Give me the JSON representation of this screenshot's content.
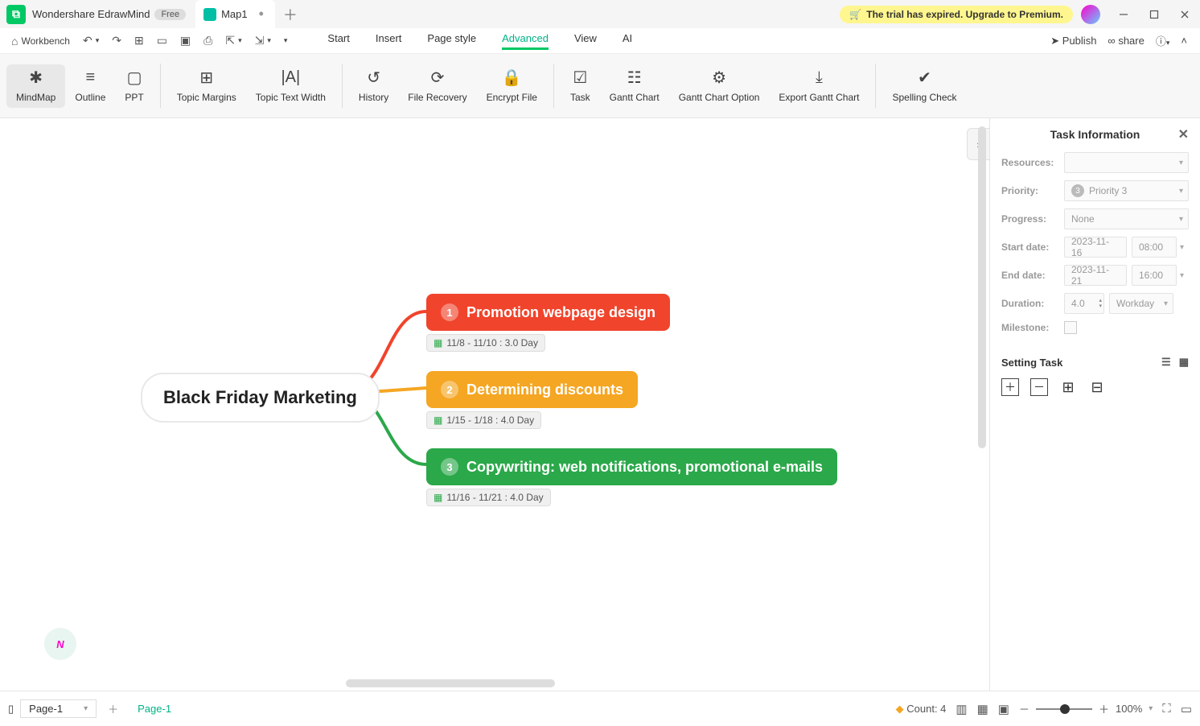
{
  "titlebar": {
    "app_name": "Wondershare EdrawMind",
    "free_badge": "Free",
    "tab_name": "Map1",
    "trial_msg": "The trial has expired. Upgrade to Premium."
  },
  "quickbar": {
    "workbench": "Workbench"
  },
  "menu": {
    "items": [
      "Start",
      "Insert",
      "Page style",
      "Advanced",
      "View",
      "AI"
    ],
    "active": "Advanced"
  },
  "top_actions": {
    "publish": "Publish",
    "share": "share"
  },
  "ribbon": {
    "view": [
      {
        "id": "mindmap",
        "label": "MindMap"
      },
      {
        "id": "outline",
        "label": "Outline"
      },
      {
        "id": "ppt",
        "label": "PPT"
      }
    ],
    "topic": [
      {
        "id": "topic-margins",
        "label": "Topic Margins"
      },
      {
        "id": "topic-text-width",
        "label": "Topic Text Width"
      }
    ],
    "tools": [
      {
        "id": "history",
        "label": "History"
      },
      {
        "id": "file-recovery",
        "label": "File Recovery"
      },
      {
        "id": "encrypt-file",
        "label": "Encrypt File"
      }
    ],
    "task": [
      {
        "id": "task",
        "label": "Task"
      },
      {
        "id": "gantt-chart",
        "label": "Gantt Chart"
      },
      {
        "id": "gantt-chart-option",
        "label": "Gantt Chart Option"
      },
      {
        "id": "export-gantt-chart",
        "label": "Export Gantt Chart"
      }
    ],
    "spell": [
      {
        "id": "spelling-check",
        "label": "Spelling Check"
      }
    ]
  },
  "mindmap": {
    "central": "Black Friday Marketing",
    "nodes": [
      {
        "num": "1",
        "text": "Promotion webpage design",
        "date": "11/8 - 11/10 : 3.0 Day"
      },
      {
        "num": "2",
        "text": "Determining discounts",
        "date": "1/15 - 1/18 : 4.0 Day"
      },
      {
        "num": "3",
        "text": "Copywriting: web notifications, promotional e-mails",
        "date": "11/16 - 11/21 : 4.0 Day"
      }
    ]
  },
  "panel": {
    "title": "Task Information",
    "resources_label": "Resources:",
    "resources_val": "",
    "priority_label": "Priority:",
    "priority_val": "Priority 3",
    "progress_label": "Progress:",
    "progress_val": "None",
    "start_label": "Start date:",
    "start_date": "2023-11-16",
    "start_time": "08:00",
    "end_label": "End date:",
    "end_date": "2023-11-21",
    "end_time": "16:00",
    "duration_label": "Duration:",
    "duration_val": "4.0",
    "duration_unit": "Workday",
    "milestone_label": "Milestone:",
    "setting_title": "Setting Task"
  },
  "status": {
    "page_sel": "Page-1",
    "page_tab": "Page-1",
    "count_label": "Count: 4",
    "zoom": "100%"
  }
}
